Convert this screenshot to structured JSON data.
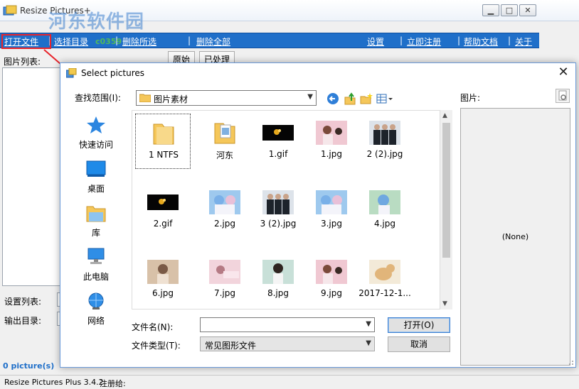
{
  "app": {
    "title": "Resize Pictures+",
    "watermark": "河东软件园",
    "watermark_url": "c0359",
    "window_buttons": {
      "minimize": "▁",
      "maximize": "□",
      "close": "✕"
    },
    "menu": [
      "打开文件",
      "选择目录",
      "删除所选",
      "删除全部",
      "设置",
      "立即注册",
      "帮助文档",
      "关于"
    ],
    "list_label": "图片列表:",
    "preview_tabs": [
      "原始",
      "已处理"
    ],
    "settings_label": "设置列表:",
    "output_label": "输出目录:",
    "picture_count": "0 picture(s)",
    "status_version": "Resize Pictures Plus 3.4.2",
    "status_register": "注册给:"
  },
  "dialog": {
    "title": "Select pictures",
    "close": "✕",
    "look_in_label": "查找范围(I):",
    "look_in_value": "图片素材",
    "preview_label": "图片:",
    "preview_none": "(None)",
    "places": [
      "快速访问",
      "桌面",
      "库",
      "此电脑",
      "网络"
    ],
    "files": [
      {
        "name": "1 NTFS",
        "kind": "folder"
      },
      {
        "name": "河东",
        "kind": "folder-docs"
      },
      {
        "name": "1.gif",
        "kind": "gif"
      },
      {
        "name": "1.jpg",
        "kind": "photo-pink"
      },
      {
        "name": "2 (2).jpg",
        "kind": "photo-suits"
      },
      {
        "name": "2.gif",
        "kind": "gif"
      },
      {
        "name": "2.jpg",
        "kind": "anime-blue"
      },
      {
        "name": "3 (2).jpg",
        "kind": "photo-suits"
      },
      {
        "name": "3.jpg",
        "kind": "anime-blue"
      },
      {
        "name": "4.jpg",
        "kind": "anime-green"
      },
      {
        "name": "6.jpg",
        "kind": "photo-portrait"
      },
      {
        "name": "7.jpg",
        "kind": "photo-soft"
      },
      {
        "name": "8.jpg",
        "kind": "photo-girl"
      },
      {
        "name": "9.jpg",
        "kind": "photo-pink"
      },
      {
        "name": "2017-12-1...",
        "kind": "photo-dog"
      }
    ],
    "file_name_label": "文件名(N):",
    "file_name_value": "",
    "file_type_label": "文件类型(T):",
    "file_type_value": "常见图形文件",
    "open_button": "打开(O)",
    "cancel_button": "取消"
  },
  "colors": {
    "menubar": "#1f6fc9",
    "annotation": "#e8232a"
  }
}
